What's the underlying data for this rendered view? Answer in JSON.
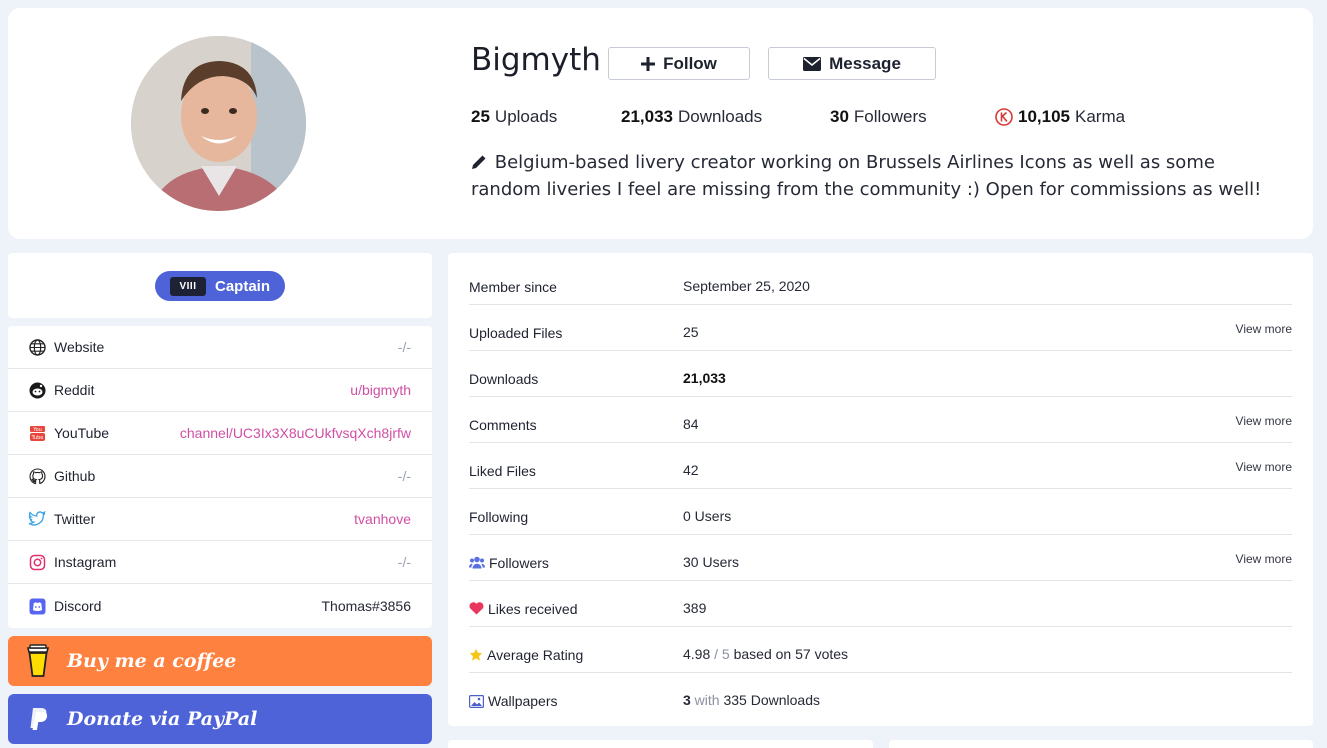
{
  "profile": {
    "username": "Bigmyth",
    "follow_label": "Follow",
    "message_label": "Message",
    "stats": [
      {
        "value": "25",
        "label": "Uploads"
      },
      {
        "value": "21,033",
        "label": "Downloads"
      },
      {
        "value": "30",
        "label": "Followers"
      },
      {
        "value": "10,105",
        "label": "Karma"
      }
    ],
    "bio": "Belgium-based livery creator working on Brussels Airlines Icons as well as some random liveries I feel are missing from the community :) Open for commissions as well!"
  },
  "rank": {
    "numeral": "VIII",
    "title": "Captain",
    "color": "#4f63d8"
  },
  "social": [
    {
      "label": "Website",
      "value": "-/-",
      "icon": "globe-icon"
    },
    {
      "label": "Reddit",
      "value": "u/bigmyth",
      "icon": "reddit-icon"
    },
    {
      "label": "YouTube",
      "value": "channel/UC3Ix3X8uCUkfvsqXch8jrfw",
      "icon": "youtube-icon"
    },
    {
      "label": "Github",
      "value": "-/-",
      "icon": "github-icon"
    },
    {
      "label": "Twitter",
      "value": "tvanhove",
      "icon": "twitter-icon"
    },
    {
      "label": "Instagram",
      "value": "-/-",
      "icon": "instagram-icon"
    },
    {
      "label": "Discord",
      "value": "Thomas#3856",
      "icon": "discord-icon"
    }
  ],
  "donate": {
    "coffee_label": "Buy me a coffee",
    "paypal_label": "Donate via PayPal",
    "coffee_color": "#ff813f",
    "paypal_color": "#4f63d8"
  },
  "info": {
    "view_more": "View more",
    "member_since": {
      "label": "Member since",
      "value": "September 25, 2020"
    },
    "uploaded_files": {
      "label": "Uploaded Files",
      "value": "25"
    },
    "downloads": {
      "label": "Downloads",
      "value": "21,033"
    },
    "comments": {
      "label": "Comments",
      "value": "84"
    },
    "liked_files": {
      "label": "Liked Files",
      "value": "42"
    },
    "following": {
      "label": "Following",
      "value": "0 Users"
    },
    "followers": {
      "label": "Followers",
      "value": "30 Users"
    },
    "likes_received": {
      "label": "Likes received",
      "value": "389"
    },
    "average_rating": {
      "label": "Average Rating",
      "value": "4.98",
      "sep": " / ",
      "max": "5",
      "suffix": " based on 57 votes"
    },
    "wallpapers": {
      "label": "Wallpapers",
      "count": "3",
      "with": " with ",
      "downloads": "335 Downloads"
    }
  },
  "colors": {
    "accent": "#4f63d8",
    "link": "#d14ea5",
    "karma": "#d63b3b"
  }
}
